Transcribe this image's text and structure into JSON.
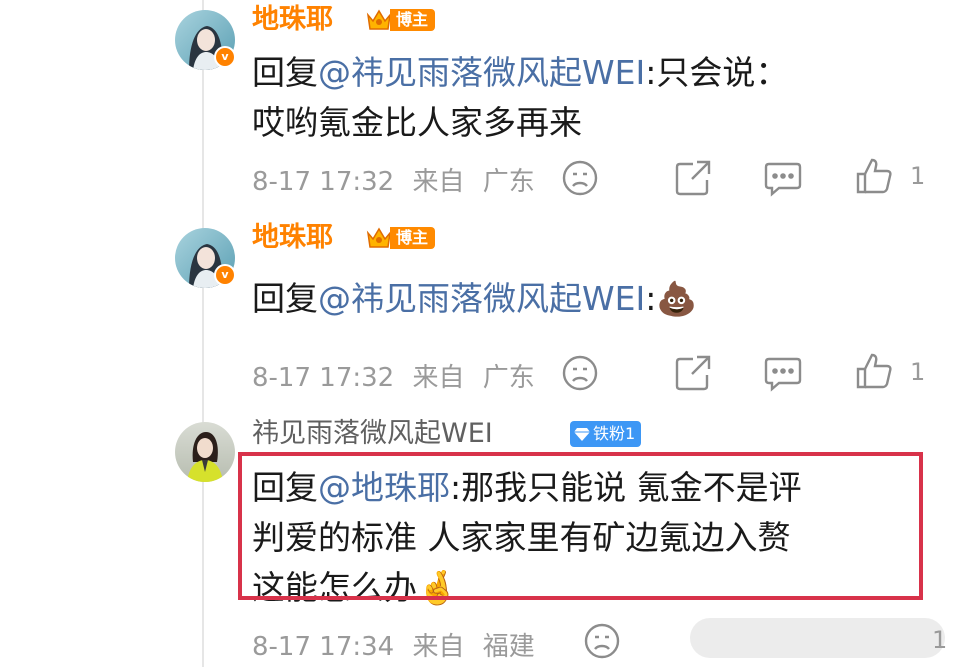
{
  "comments": [
    {
      "username": "地珠耶",
      "badge": "博主",
      "reply_prefix": "回复",
      "mention": "@祎见雨落微风起WEI",
      "text": ":只会说：\n哎哟氪金比人家多再来",
      "time": "8-17 17:32",
      "source_prefix": "来自",
      "location": "广东",
      "like_count": "1"
    },
    {
      "username": "地珠耶",
      "badge": "博主",
      "reply_prefix": "回复",
      "mention": "@祎见雨落微风起WEI",
      "text": ":💩",
      "time": "8-17 17:32",
      "source_prefix": "来自",
      "location": "广东",
      "like_count": "1"
    },
    {
      "username": "祎见雨落微风起WEI",
      "badge": "铁粉1",
      "reply_prefix": "回复",
      "mention": "@地珠耶",
      "text": ":那我只能说 氪金不是评\n判爱的标准 人家家里有矿边氪边入赘\n这能怎么办🤞",
      "time": "8-17 17:34",
      "source_prefix": "来自",
      "location": "福建",
      "like_count": "1"
    }
  ],
  "colors": {
    "brand_orange": "#ff8200",
    "mention_blue": "#4a6fa5",
    "highlight_red": "#d8324a",
    "fan_badge_blue": "#3d97f5"
  },
  "icons": [
    "dislike-icon",
    "share-icon",
    "comment-icon",
    "like-icon",
    "verified-icon",
    "crown-icon",
    "diamond-icon"
  ]
}
